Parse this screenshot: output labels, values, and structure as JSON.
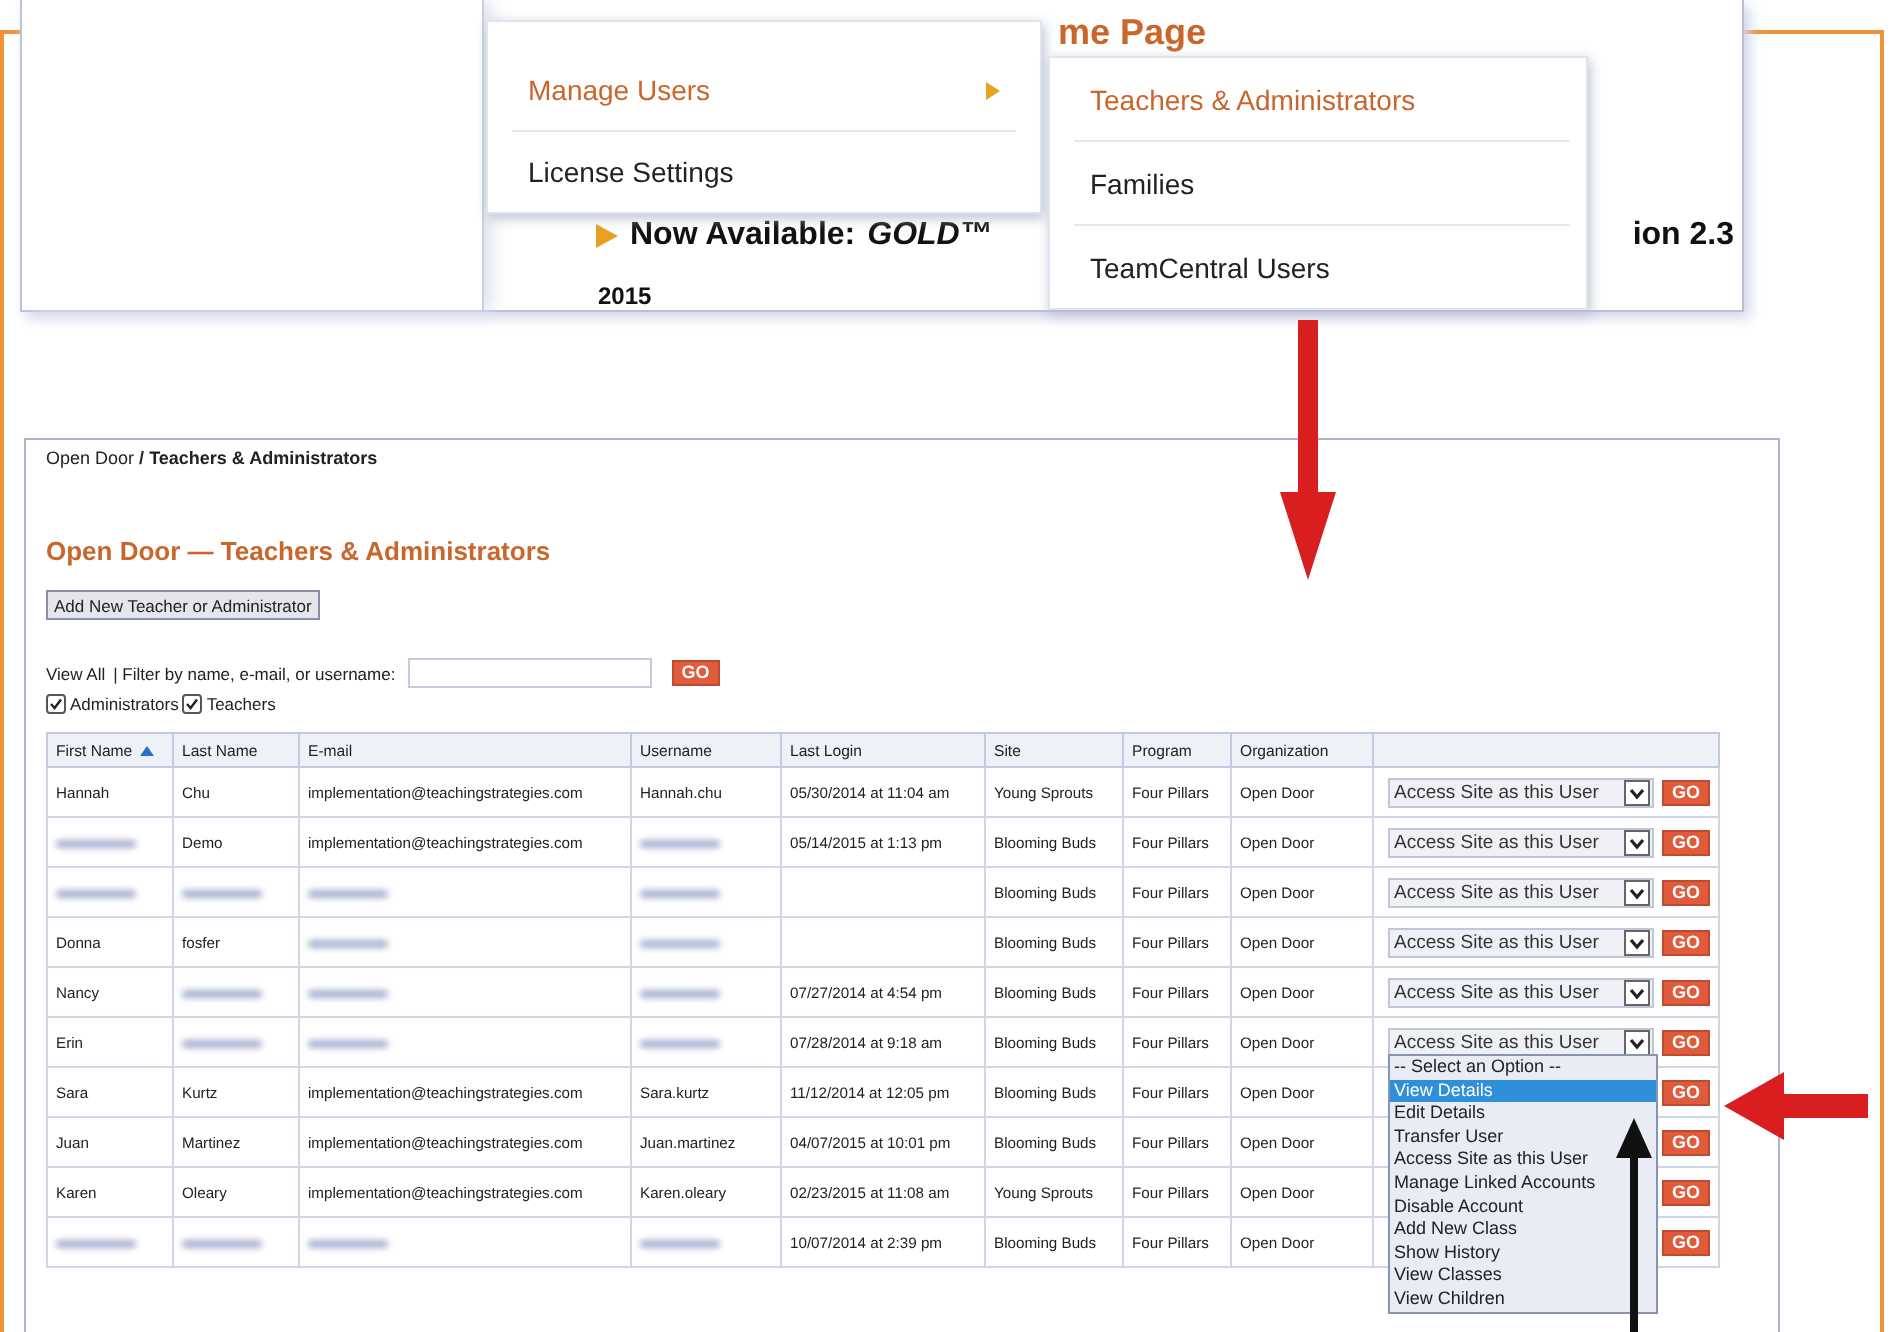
{
  "top_screenshot": {
    "page_heading": "me Page",
    "announcement": {
      "label": "Now Available:",
      "product": "GOLD™",
      "trailing": "ion 2.3"
    },
    "year": "2015",
    "menu": [
      {
        "label": "Manage Users",
        "has_submenu": true,
        "selected": true
      },
      {
        "label": "License Settings",
        "has_submenu": false,
        "selected": false
      }
    ],
    "submenu": [
      {
        "label": "Teachers & Administrators",
        "selected": true
      },
      {
        "label": "Families",
        "selected": false
      },
      {
        "label": "TeamCentral Users",
        "selected": false
      }
    ]
  },
  "bottom_screenshot": {
    "breadcrumb": {
      "root": "Open Door",
      "separator": "/",
      "current": "Teachers & Administrators"
    },
    "title": "Open Door — Teachers & Administrators",
    "add_button": "Add New Teacher or Administrator",
    "filter": {
      "view_all": "View All",
      "label": "| Filter by name, e-mail, or username:",
      "go": "GO"
    },
    "checkboxes": [
      {
        "label": "Administrators",
        "checked": true
      },
      {
        "label": "Teachers",
        "checked": true
      }
    ],
    "table": {
      "columns": [
        {
          "label": "First Name",
          "sorted": true
        },
        {
          "label": "Last Name",
          "sorted": false
        },
        {
          "label": "E-mail",
          "sorted": false
        },
        {
          "label": "Username",
          "sorted": false
        },
        {
          "label": "Last Login",
          "sorted": false
        },
        {
          "label": "Site",
          "sorted": false
        },
        {
          "label": "Program",
          "sorted": false
        },
        {
          "label": "Organization",
          "sorted": false
        }
      ],
      "rows": [
        {
          "cells": [
            {
              "text": "Hannah"
            },
            {
              "text": "Chu"
            },
            {
              "text": "implementation@teachingstrategies.com"
            },
            {
              "text": "Hannah.chu"
            },
            {
              "text": "05/30/2014 at 11:04 am"
            },
            {
              "text": "Young Sprouts"
            },
            {
              "text": "Four Pillars"
            },
            {
              "text": "Open Door"
            }
          ],
          "action": "Access Site as this User",
          "go": "GO"
        },
        {
          "cells": [
            {
              "blurred": true
            },
            {
              "text": "Demo"
            },
            {
              "text": "implementation@teachingstrategies.com"
            },
            {
              "blurred": true
            },
            {
              "text": "05/14/2015 at 1:13 pm"
            },
            {
              "text": "Blooming Buds"
            },
            {
              "text": "Four Pillars"
            },
            {
              "text": "Open Door"
            }
          ],
          "action": "Access Site as this User",
          "go": "GO"
        },
        {
          "cells": [
            {
              "blurred": true
            },
            {
              "blurred": true
            },
            {
              "blurred": true
            },
            {
              "blurred": true
            },
            {
              "blurred": false
            },
            {
              "text": "Blooming Buds"
            },
            {
              "text": "Four Pillars"
            },
            {
              "text": "Open Door"
            }
          ],
          "action": "Access Site as this User",
          "go": "GO"
        },
        {
          "cells": [
            {
              "text": "Donna"
            },
            {
              "text": "fosfer"
            },
            {
              "blurred": true
            },
            {
              "blurred": true
            },
            {
              "blurred": false
            },
            {
              "text": "Blooming Buds"
            },
            {
              "text": "Four Pillars"
            },
            {
              "text": "Open Door"
            }
          ],
          "action": "Access Site as this User",
          "go": "GO"
        },
        {
          "cells": [
            {
              "text": "Nancy"
            },
            {
              "blurred": true
            },
            {
              "blurred": true
            },
            {
              "blurred": true
            },
            {
              "text": "07/27/2014 at 4:54 pm"
            },
            {
              "text": "Blooming Buds"
            },
            {
              "text": "Four Pillars"
            },
            {
              "text": "Open Door"
            }
          ],
          "action": "Access Site as this User",
          "go": "GO"
        },
        {
          "cells": [
            {
              "text": "Erin"
            },
            {
              "blurred": true
            },
            {
              "blurred": true
            },
            {
              "blurred": true
            },
            {
              "text": "07/28/2014 at 9:18 am"
            },
            {
              "text": "Blooming Buds"
            },
            {
              "text": "Four Pillars"
            },
            {
              "text": "Open Door"
            }
          ],
          "action": "Access Site as this User",
          "go": "GO",
          "dropdown": [
            {
              "label": "-- Select an Option --",
              "selected": false
            },
            {
              "label": "View Details",
              "selected": true
            },
            {
              "label": "Edit Details",
              "selected": false
            },
            {
              "label": "Transfer User",
              "selected": false
            },
            {
              "label": "Access Site as this User",
              "selected": false
            },
            {
              "label": "Manage Linked Accounts",
              "selected": false
            },
            {
              "label": "Disable Account",
              "selected": false
            },
            {
              "label": "Add New Class",
              "selected": false
            },
            {
              "label": "Show History",
              "selected": false
            },
            {
              "label": "View Classes",
              "selected": false
            },
            {
              "label": "View Children",
              "selected": false
            }
          ]
        },
        {
          "cells": [
            {
              "text": "Sara"
            },
            {
              "text": "Kurtz"
            },
            {
              "text": "implementation@teachingstrategies.com"
            },
            {
              "text": "Sara.kurtz"
            },
            {
              "text": "11/12/2014 at 12:05 pm"
            },
            {
              "text": "Blooming Buds"
            },
            {
              "text": "Four Pillars"
            },
            {
              "text": "Open Door"
            }
          ],
          "go": "GO"
        },
        {
          "cells": [
            {
              "text": "Juan"
            },
            {
              "text": "Martinez"
            },
            {
              "text": "implementation@teachingstrategies.com"
            },
            {
              "text": "Juan.martinez"
            },
            {
              "text": "04/07/2015 at 10:01 pm"
            },
            {
              "text": "Blooming Buds"
            },
            {
              "text": "Four Pillars"
            },
            {
              "text": "Open Door"
            }
          ],
          "go": "GO"
        },
        {
          "cells": [
            {
              "text": "Karen"
            },
            {
              "text": "Oleary"
            },
            {
              "text": "implementation@teachingstrategies.com"
            },
            {
              "text": "Karen.oleary"
            },
            {
              "text": "02/23/2015 at 11:08 am"
            },
            {
              "text": "Young Sprouts"
            },
            {
              "text": "Four Pillars"
            },
            {
              "text": "Open Door"
            }
          ],
          "go": "GO"
        },
        {
          "cells": [
            {
              "blurred": true
            },
            {
              "blurred": true
            },
            {
              "blurred": true
            },
            {
              "blurred": true
            },
            {
              "text": "10/07/2014 at 2:39 pm"
            },
            {
              "text": "Blooming Buds"
            },
            {
              "text": "Four Pillars"
            },
            {
              "text": "Open Door"
            }
          ],
          "go": "GO"
        }
      ]
    }
  }
}
